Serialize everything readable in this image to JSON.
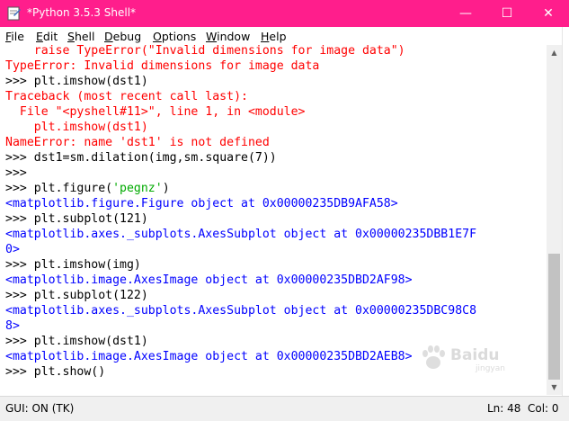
{
  "window": {
    "title": "*Python 3.5.3 Shell*",
    "minimize_glyph": "—",
    "maximize_glyph": "☐",
    "close_glyph": "✕",
    "titlebar_color": "#ff1e8c"
  },
  "menu": {
    "items": [
      {
        "first": "F",
        "rest": "ile"
      },
      {
        "first": "E",
        "rest": "dit"
      },
      {
        "first": "S",
        "rest": "hell"
      },
      {
        "first": "D",
        "rest": "ebug"
      },
      {
        "first": "O",
        "rest": "ptions"
      },
      {
        "first": "W",
        "rest": "indow"
      },
      {
        "first": "H",
        "rest": "elp"
      }
    ]
  },
  "shell": {
    "lines": [
      {
        "kind": "err",
        "text": "    raise TypeError(\"Invalid dimensions for image data\")"
      },
      {
        "kind": "err",
        "text": "TypeError: Invalid dimensions for image data"
      },
      {
        "kind": "cmd",
        "prompt": ">>> ",
        "text": "plt.imshow(dst1)"
      },
      {
        "kind": "err",
        "text": "Traceback (most recent call last):"
      },
      {
        "kind": "err",
        "text": "  File \"<pyshell#11>\", line 1, in <module>"
      },
      {
        "kind": "err",
        "text": "    plt.imshow(dst1)"
      },
      {
        "kind": "err",
        "text": "NameError: name 'dst1' is not defined"
      },
      {
        "kind": "cmd",
        "prompt": ">>> ",
        "text": "dst1=sm.dilation(img,sm.square(7))"
      },
      {
        "kind": "cmd",
        "prompt": ">>> ",
        "text": ""
      },
      {
        "kind": "cmdstr",
        "prompt": ">>> ",
        "pre": "plt.figure(",
        "str": "'pegnz'",
        "post": ")"
      },
      {
        "kind": "out",
        "text": "<matplotlib.figure.Figure object at 0x00000235DB9AFA58>"
      },
      {
        "kind": "cmd",
        "prompt": ">>> ",
        "text": "plt.subplot(121)"
      },
      {
        "kind": "out",
        "text": "<matplotlib.axes._subplots.AxesSubplot object at 0x00000235DBB1E7F"
      },
      {
        "kind": "out",
        "text": "0>"
      },
      {
        "kind": "cmd",
        "prompt": ">>> ",
        "text": "plt.imshow(img)"
      },
      {
        "kind": "out",
        "text": "<matplotlib.image.AxesImage object at 0x00000235DBD2AF98>"
      },
      {
        "kind": "cmd",
        "prompt": ">>> ",
        "text": "plt.subplot(122)"
      },
      {
        "kind": "out",
        "text": "<matplotlib.axes._subplots.AxesSubplot object at 0x00000235DBC98C8"
      },
      {
        "kind": "out",
        "text": "8>"
      },
      {
        "kind": "cmd",
        "prompt": ">>> ",
        "text": "plt.imshow(dst1)"
      },
      {
        "kind": "out",
        "text": "<matplotlib.image.AxesImage object at 0x00000235DBD2AEB8>"
      },
      {
        "kind": "cmd",
        "prompt": ">>> ",
        "text": "plt.show()"
      }
    ]
  },
  "status": {
    "left": "GUI: ON (TK)",
    "line": "Ln: 48",
    "col": "Col: 0"
  },
  "watermark": {
    "text": "Baidu",
    "sub": "jingyan"
  },
  "colors": {
    "error": "#ff0000",
    "output": "#0000ff",
    "string": "#00aa00"
  }
}
